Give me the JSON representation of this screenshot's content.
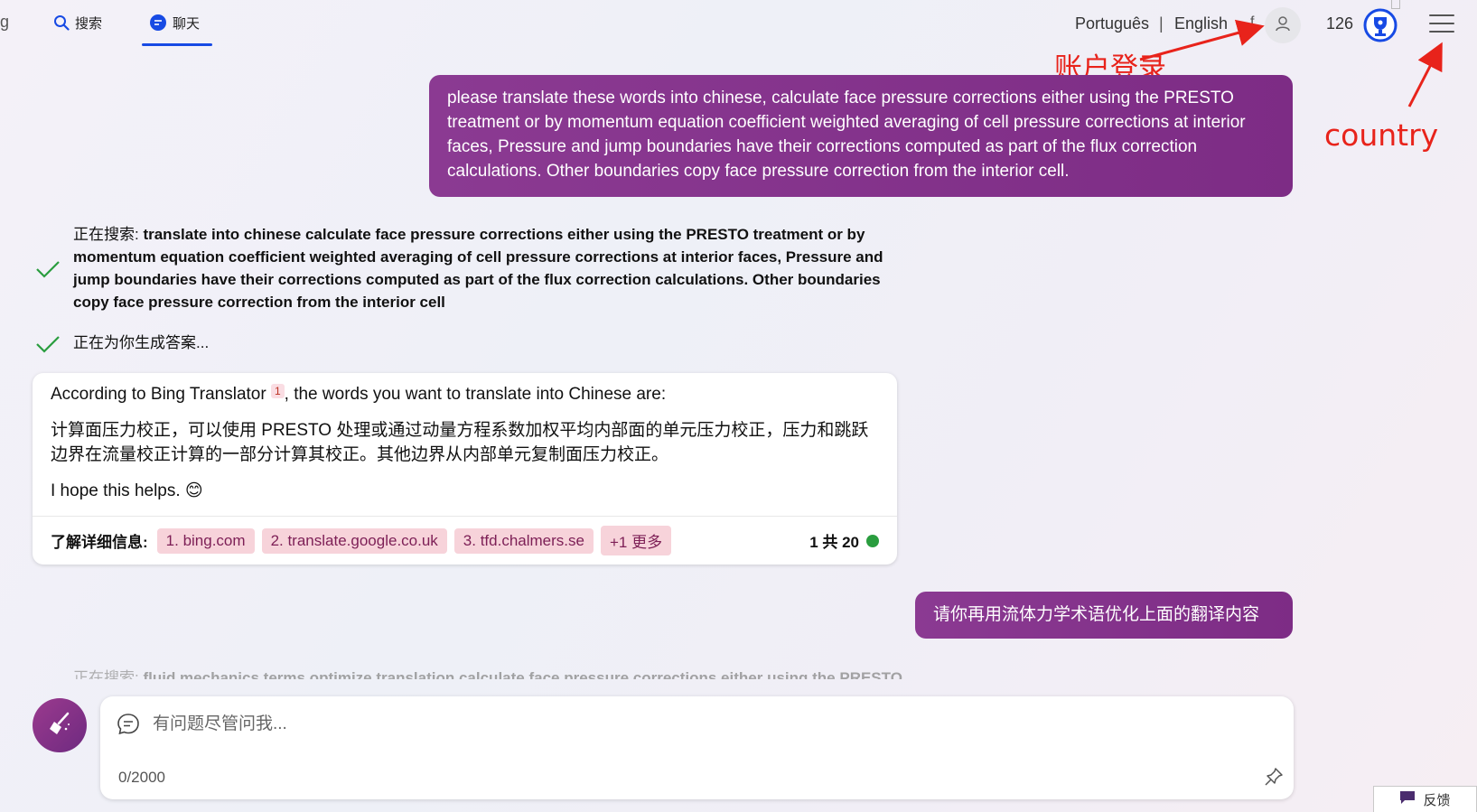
{
  "header": {
    "edge_letter": "g",
    "tabs": [
      {
        "label": "搜索",
        "icon": "search-icon"
      },
      {
        "label": "聊天",
        "icon": "chat-icon",
        "active": true
      }
    ],
    "languages": [
      "Português",
      "English"
    ],
    "language_separator": "|",
    "truncated_text": "f",
    "points": "126",
    "accent_color": "#174ae4"
  },
  "annotations": {
    "account_login": "账户登录",
    "country": "country",
    "color": "#e8231b"
  },
  "conversation": {
    "user_message_1": "please translate these words into chinese, calculate face pressure corrections either using the PRESTO treatment or by momentum equation coefficient weighted averaging of cell pressure corrections at interior faces, Pressure and jump boundaries have their corrections computed as part of the flux correction calculations. Other boundaries copy face pressure correction from the interior cell.",
    "progress_1_prefix": "正在搜索: ",
    "progress_1_query": "translate into chinese calculate face pressure corrections either using the PRESTO treatment or by momentum equation coefficient weighted averaging of cell pressure corrections at interior faces, Pressure and jump boundaries have their corrections computed as part of the flux correction calculations. Other boundaries copy face pressure correction from the interior cell",
    "progress_2": "正在为你生成答案...",
    "answer": {
      "intro_before": "According to Bing Translator",
      "citation": "1",
      "intro_after": ", the words you want to translate into Chinese are:",
      "translation": "计算面压力校正，可以使用 PRESTO 处理或通过动量方程系数加权平均内部面的单元压力校正，压力和跳跃边界在流量校正计算的一部分计算其校正。其他边界从内部单元复制面压力校正。",
      "closing": "I hope this helps. 😊",
      "learn_more": "了解详细信息:",
      "sources": [
        "1. bing.com",
        "2. translate.google.co.uk",
        "3. tfd.chalmers.se",
        "+1 更多"
      ],
      "pager": "1 共 20",
      "status_color": "#2a9d3f"
    },
    "user_message_2": "请你再用流体力学术语优化上面的翻译内容",
    "progress_3_prefix": "正在搜索: ",
    "progress_3_query": "fluid mechanics terms optimize translation calculate face pressure corrections either using the PRESTO"
  },
  "input": {
    "placeholder": "有问题尽管问我...",
    "value": "",
    "counter": "0/2000"
  },
  "feedback": {
    "label": "反馈"
  },
  "colors": {
    "bubble": "#8b3a92",
    "source_chip": "#f7d3da"
  }
}
